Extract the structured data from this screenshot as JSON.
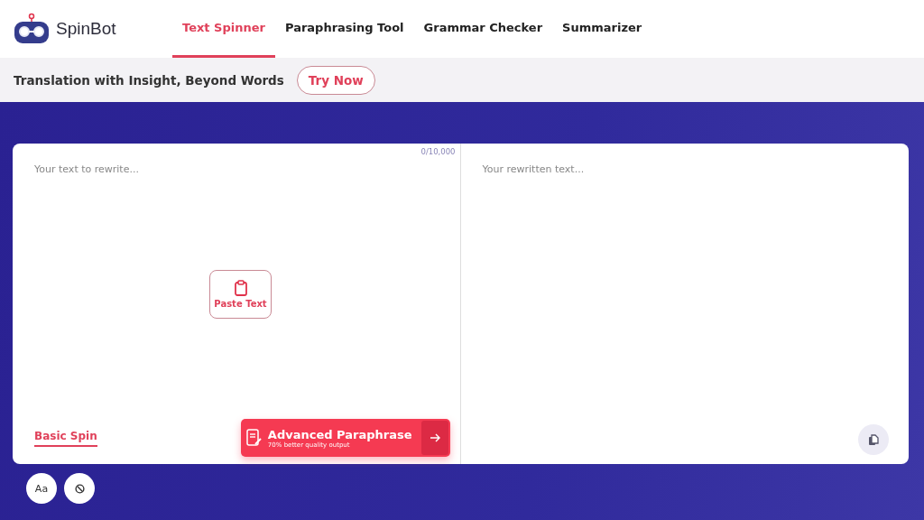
{
  "brand": "SpinBot",
  "nav": [
    {
      "label": "Text Spinner",
      "selected": true
    },
    {
      "label": "Paraphrasing Tool",
      "selected": false
    },
    {
      "label": "Grammar Checker",
      "selected": false
    },
    {
      "label": "Summarizer",
      "selected": false
    }
  ],
  "promo": {
    "text": "Translation with Insight, Beyond Words",
    "button": "Try Now"
  },
  "input": {
    "placeholder": "Your text to rewrite...",
    "counter": "0/10,000",
    "paste": "Paste Text"
  },
  "modes": [
    {
      "label": "Basic Spin",
      "selected": true
    }
  ],
  "advanced": {
    "title": "Advanced Paraphrase",
    "subtitle": "70% better quality output"
  },
  "output": {
    "placeholder": "Your rewritten text..."
  },
  "font_button": "Aa"
}
